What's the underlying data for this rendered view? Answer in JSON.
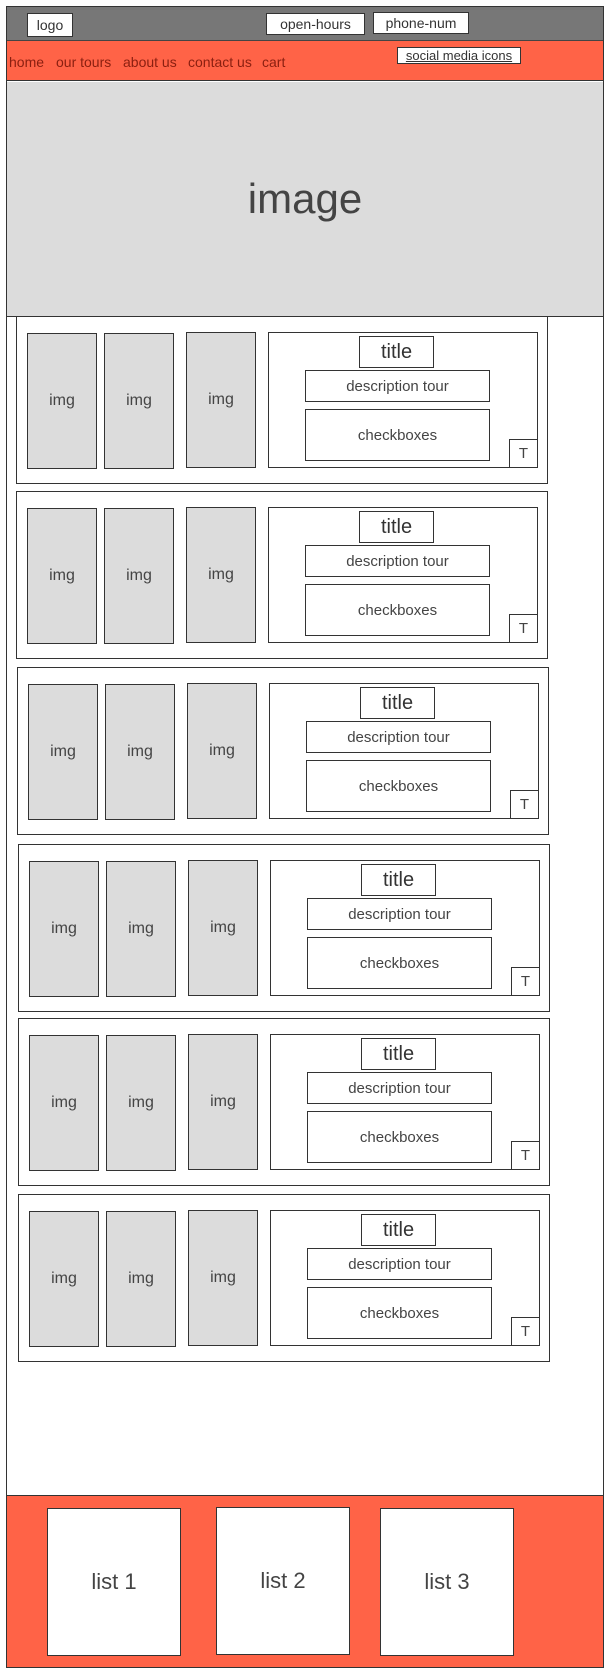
{
  "header": {
    "logo": "logo",
    "open_hours": "open-hours",
    "phone": "phone-num"
  },
  "nav": {
    "items": [
      "home",
      "our tours",
      "about us",
      "contact us",
      "cart"
    ],
    "social": "social media icons"
  },
  "hero": {
    "label": "image"
  },
  "tours": [
    {
      "images": [
        "img",
        "img",
        "img"
      ],
      "title": "title",
      "description": "description tour",
      "checkboxes": "checkboxes",
      "t": "T"
    },
    {
      "images": [
        "img",
        "img",
        "img"
      ],
      "title": "title",
      "description": "description tour",
      "checkboxes": "checkboxes",
      "t": "T"
    },
    {
      "images": [
        "img",
        "img",
        "img"
      ],
      "title": "title",
      "description": "description tour",
      "checkboxes": "checkboxes",
      "t": "T"
    },
    {
      "images": [
        "img",
        "img",
        "img"
      ],
      "title": "title",
      "description": "description tour",
      "checkboxes": "checkboxes",
      "t": "T"
    },
    {
      "images": [
        "img",
        "img",
        "img"
      ],
      "title": "title",
      "description": "description tour",
      "checkboxes": "checkboxes",
      "t": "T"
    },
    {
      "images": [
        "img",
        "img",
        "img"
      ],
      "title": "title",
      "description": "description tour",
      "checkboxes": "checkboxes",
      "t": "T"
    }
  ],
  "footer": {
    "lists": [
      "list 1",
      "list 2",
      "list 3"
    ]
  },
  "colors": {
    "accent": "#ff6347",
    "topbar": "#777777",
    "placeholder": "#dcdcdc"
  }
}
